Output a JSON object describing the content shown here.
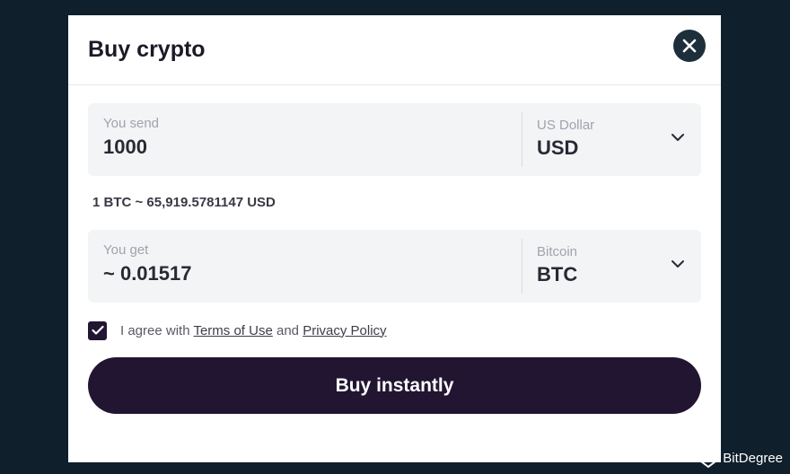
{
  "modal": {
    "title": "Buy crypto"
  },
  "send": {
    "label": "You send",
    "value": "1000",
    "currency_name": "US Dollar",
    "currency_code": "USD"
  },
  "rate": "1 BTC ~ 65,919.5781147 USD",
  "get": {
    "label": "You get",
    "value": "~ 0.01517",
    "currency_name": "Bitcoin",
    "currency_code": "BTC"
  },
  "agreement": {
    "checked": true,
    "prefix": "I agree with ",
    "terms_link": "Terms of Use",
    "middle": " and ",
    "privacy_link": "Privacy Policy"
  },
  "buy_button": "Buy instantly",
  "watermark": "BitDegree",
  "colors": {
    "primary": "#221532",
    "background": "#0f1f2b",
    "field_bg": "#f3f4f6",
    "close_bg": "#1e2f3c"
  },
  "icons": {
    "close": "close-icon",
    "dropdown": "chevron-down-icon",
    "checkmark": "checkmark-icon",
    "brand": "bitdegree-logo-icon"
  }
}
